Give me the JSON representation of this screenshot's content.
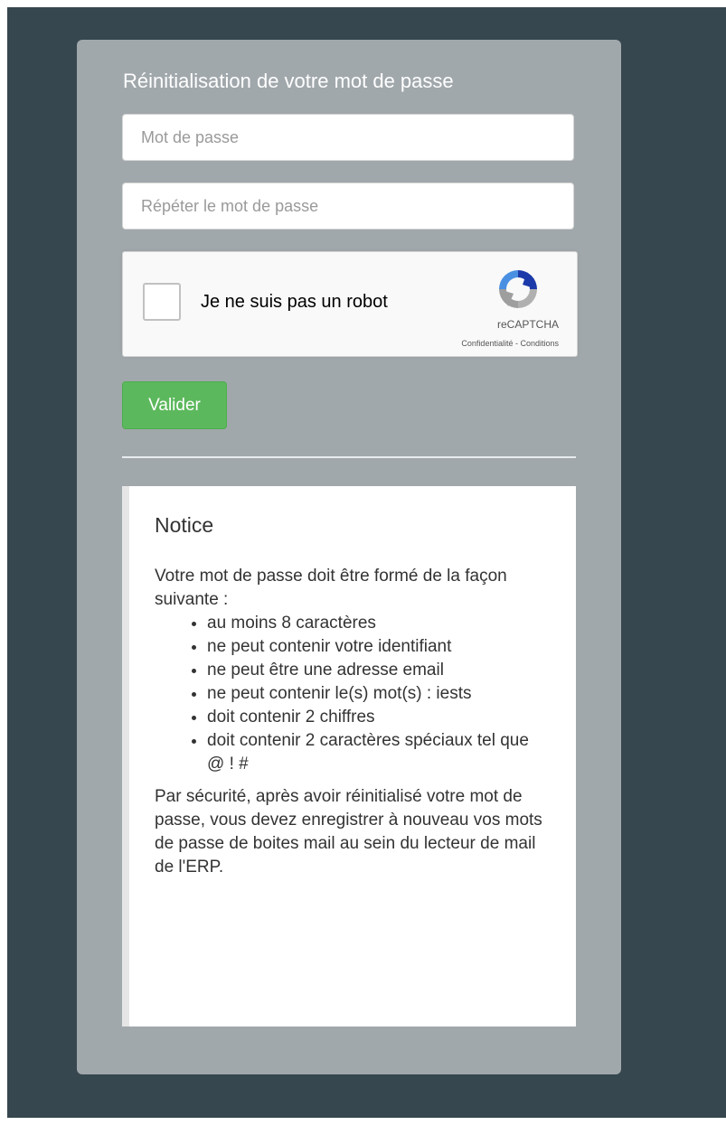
{
  "card": {
    "title": "Réinitialisation de votre mot de passe"
  },
  "form": {
    "password": {
      "placeholder": "Mot de passe",
      "value": ""
    },
    "password_repeat": {
      "placeholder": "Répéter le mot de passe",
      "value": ""
    },
    "captcha": {
      "label": "Je ne suis pas un robot",
      "brand": "reCAPTCHA",
      "privacy_link": "Confidentialité",
      "separator": " - ",
      "terms_link": "Conditions",
      "checked": false,
      "icon": "recaptcha-icon"
    },
    "submit_label": "Valider"
  },
  "notice": {
    "title": "Notice",
    "intro": "Votre mot de passe doit être formé de la façon suivante :",
    "rules": [
      "au moins 8 caractères",
      "ne peut contenir votre identifiant",
      "ne peut être une adresse email",
      "ne peut contenir le(s) mot(s) : iests",
      "doit contenir 2 chiffres",
      "doit contenir 2 caractères spéciaux tel que @ ! #"
    ],
    "footer": "Par sécurité, après avoir réinitialisé votre mot de passe, vous devez enregistrer à nouveau vos mots de passe de boites mail au sein du lecteur de mail de l'ERP."
  },
  "colors": {
    "page_background": "#37474f",
    "card_background": "#a1a8ac",
    "submit_button": "#5cb85c"
  }
}
